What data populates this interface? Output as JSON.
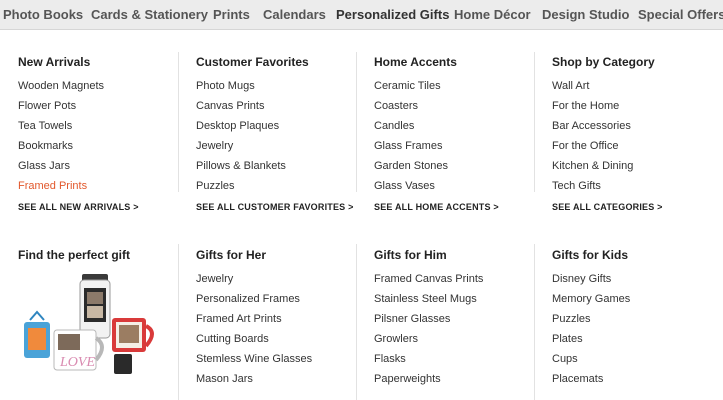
{
  "topnav": {
    "items": [
      {
        "label": "Photo Books"
      },
      {
        "label": "Cards & Stationery"
      },
      {
        "label": "Prints"
      },
      {
        "label": "Calendars"
      },
      {
        "label": "Personalized Gifts"
      },
      {
        "label": "Home Décor"
      },
      {
        "label": "Design Studio"
      },
      {
        "label": "Special Offers"
      }
    ],
    "active_index": 4
  },
  "colors": {
    "nav_bg": "#ececec",
    "highlight": "#e2582c",
    "text": "#222222"
  },
  "menu": {
    "sections_top": [
      {
        "title": "New Arrivals",
        "items": [
          "Wooden Magnets",
          "Flower Pots",
          "Tea Towels",
          "Bookmarks",
          "Glass Jars",
          "Framed Prints"
        ],
        "highlighted_item": "Framed Prints",
        "see_all": "SEE ALL NEW ARRIVALS >"
      },
      {
        "title": "Customer Favorites",
        "items": [
          "Photo Mugs",
          "Canvas Prints",
          "Desktop Plaques",
          "Jewelry",
          "Pillows & Blankets",
          "Puzzles"
        ],
        "see_all": "SEE ALL CUSTOMER FAVORITES >"
      },
      {
        "title": "Home Accents",
        "items": [
          "Ceramic Tiles",
          "Coasters",
          "Candles",
          "Glass Frames",
          "Garden Stones",
          "Glass Vases"
        ],
        "see_all": "SEE ALL HOME ACCENTS >"
      },
      {
        "title": "Shop by Category",
        "items": [
          "Wall Art",
          "For the Home",
          "Bar Accessories",
          "For the Office",
          "Kitchen & Dining",
          "Tech Gifts"
        ],
        "see_all": "SEE ALL CATEGORIES >"
      }
    ],
    "find_gift": {
      "title": "Find the perfect gift",
      "image_icon": "gift-mugs-image",
      "mug_text": "LOVE"
    },
    "sections_bottom": [
      {
        "title": "Gifts for Her",
        "items": [
          "Jewelry",
          "Personalized Frames",
          "Framed Art Prints",
          "Cutting Boards",
          "Stemless Wine Glasses",
          "Mason Jars"
        ]
      },
      {
        "title": "Gifts for Him",
        "items": [
          "Framed Canvas Prints",
          "Stainless Steel Mugs",
          "Pilsner Glasses",
          "Growlers",
          "Flasks",
          "Paperweights"
        ]
      },
      {
        "title": "Gifts for Kids",
        "items": [
          "Disney Gifts",
          "Memory Games",
          "Puzzles",
          "Plates",
          "Cups",
          "Placemats"
        ]
      }
    ]
  }
}
